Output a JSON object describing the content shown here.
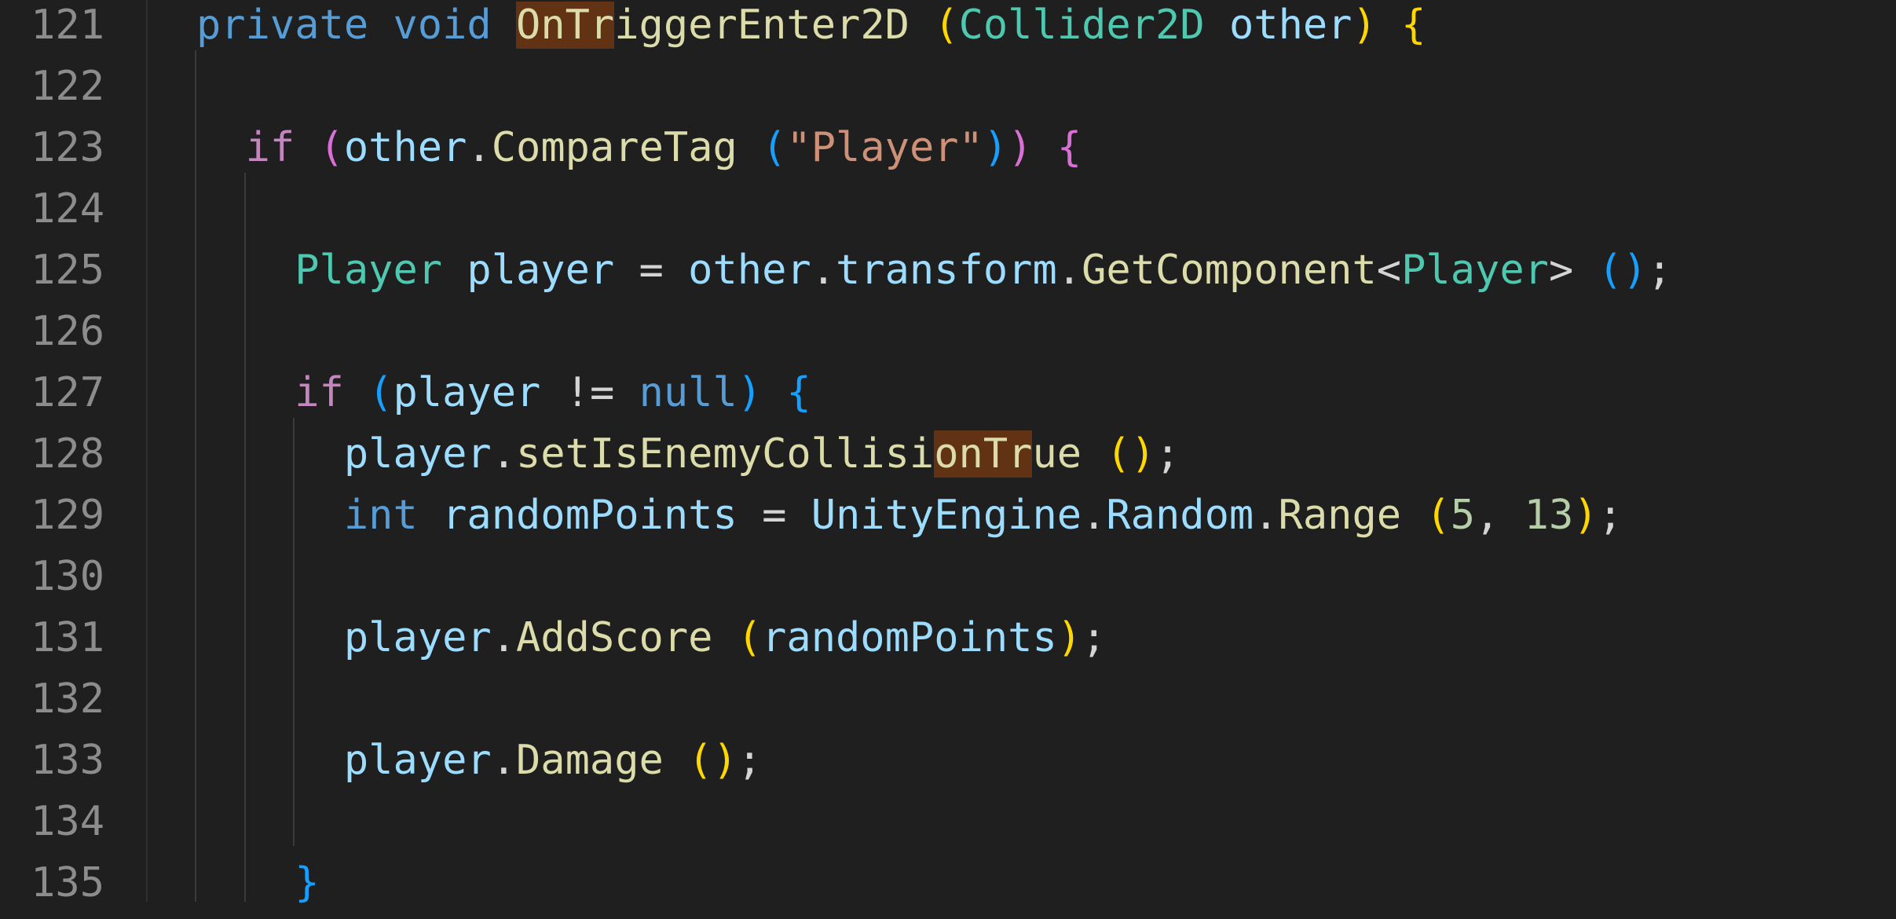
{
  "colors": {
    "background": "#1f1f1f",
    "line_number": "#8c8c8c",
    "keyword_blue": "#569cd6",
    "control_purple": "#c586c0",
    "function_yellow": "#dcdcaa",
    "type_teal": "#4ec9b0",
    "variable_lightblue": "#9cdcfe",
    "string_orange": "#ce9178",
    "number_green": "#b5cea8",
    "bracket_gold": "#ffd700",
    "bracket_orchid": "#da70d6",
    "bracket_sky": "#179fff",
    "punct": "#d4d4d4",
    "find_match": "#613214"
  },
  "lines": [
    {
      "number": "121",
      "tokens": [
        {
          "t": "private",
          "c": "keyword_blue"
        },
        {
          "t": " "
        },
        {
          "t": "void",
          "c": "keyword_blue"
        },
        {
          "t": " "
        },
        {
          "t": "OnTr",
          "c": "function_yellow",
          "hl": true
        },
        {
          "t": "iggerEnter2D",
          "c": "function_yellow"
        },
        {
          "t": " "
        },
        {
          "t": "(",
          "c": "bracket_gold"
        },
        {
          "t": "Collider2D",
          "c": "type_teal"
        },
        {
          "t": " "
        },
        {
          "t": "other",
          "c": "variable_lightblue"
        },
        {
          "t": ")",
          "c": "bracket_gold"
        },
        {
          "t": " "
        },
        {
          "t": "{",
          "c": "bracket_gold"
        }
      ]
    },
    {
      "number": "122",
      "tokens": []
    },
    {
      "number": "123",
      "tokens": [
        {
          "t": "  "
        },
        {
          "t": "if",
          "c": "control_purple"
        },
        {
          "t": " "
        },
        {
          "t": "(",
          "c": "bracket_orchid"
        },
        {
          "t": "other",
          "c": "variable_lightblue"
        },
        {
          "t": ".",
          "c": "punct"
        },
        {
          "t": "CompareTag",
          "c": "function_yellow"
        },
        {
          "t": " "
        },
        {
          "t": "(",
          "c": "bracket_sky"
        },
        {
          "t": "\"Player\"",
          "c": "string_orange"
        },
        {
          "t": ")",
          "c": "bracket_sky"
        },
        {
          "t": ")",
          "c": "bracket_orchid"
        },
        {
          "t": " "
        },
        {
          "t": "{",
          "c": "bracket_orchid"
        }
      ]
    },
    {
      "number": "124",
      "tokens": []
    },
    {
      "number": "125",
      "tokens": [
        {
          "t": "    "
        },
        {
          "t": "Player",
          "c": "type_teal"
        },
        {
          "t": " "
        },
        {
          "t": "player",
          "c": "variable_lightblue"
        },
        {
          "t": " = ",
          "c": "punct"
        },
        {
          "t": "other",
          "c": "variable_lightblue"
        },
        {
          "t": ".",
          "c": "punct"
        },
        {
          "t": "transform",
          "c": "variable_lightblue"
        },
        {
          "t": ".",
          "c": "punct"
        },
        {
          "t": "GetComponent",
          "c": "function_yellow"
        },
        {
          "t": "<",
          "c": "punct"
        },
        {
          "t": "Player",
          "c": "type_teal"
        },
        {
          "t": "> ",
          "c": "punct"
        },
        {
          "t": "()",
          "c": "bracket_sky"
        },
        {
          "t": ";",
          "c": "punct"
        }
      ]
    },
    {
      "number": "126",
      "tokens": []
    },
    {
      "number": "127",
      "tokens": [
        {
          "t": "    "
        },
        {
          "t": "if",
          "c": "control_purple"
        },
        {
          "t": " "
        },
        {
          "t": "(",
          "c": "bracket_sky"
        },
        {
          "t": "player",
          "c": "variable_lightblue"
        },
        {
          "t": " != ",
          "c": "punct"
        },
        {
          "t": "null",
          "c": "keyword_blue"
        },
        {
          "t": ")",
          "c": "bracket_sky"
        },
        {
          "t": " "
        },
        {
          "t": "{",
          "c": "bracket_sky"
        }
      ]
    },
    {
      "number": "128",
      "tokens": [
        {
          "t": "      "
        },
        {
          "t": "player",
          "c": "variable_lightblue"
        },
        {
          "t": ".",
          "c": "punct"
        },
        {
          "t": "setIsEnemyCollisi",
          "c": "function_yellow"
        },
        {
          "t": "onTr",
          "c": "function_yellow",
          "hl": true
        },
        {
          "t": "ue",
          "c": "function_yellow"
        },
        {
          "t": " "
        },
        {
          "t": "()",
          "c": "bracket_gold"
        },
        {
          "t": ";",
          "c": "punct"
        }
      ]
    },
    {
      "number": "129",
      "tokens": [
        {
          "t": "      "
        },
        {
          "t": "int",
          "c": "keyword_blue"
        },
        {
          "t": " "
        },
        {
          "t": "randomPoints",
          "c": "variable_lightblue"
        },
        {
          "t": " = ",
          "c": "punct"
        },
        {
          "t": "UnityEngine",
          "c": "variable_lightblue"
        },
        {
          "t": ".",
          "c": "punct"
        },
        {
          "t": "Random",
          "c": "variable_lightblue"
        },
        {
          "t": ".",
          "c": "punct"
        },
        {
          "t": "Range",
          "c": "function_yellow"
        },
        {
          "t": " "
        },
        {
          "t": "(",
          "c": "bracket_gold"
        },
        {
          "t": "5",
          "c": "number_green"
        },
        {
          "t": ", ",
          "c": "punct"
        },
        {
          "t": "13",
          "c": "number_green"
        },
        {
          "t": ")",
          "c": "bracket_gold"
        },
        {
          "t": ";",
          "c": "punct"
        }
      ]
    },
    {
      "number": "130",
      "tokens": []
    },
    {
      "number": "131",
      "tokens": [
        {
          "t": "      "
        },
        {
          "t": "player",
          "c": "variable_lightblue"
        },
        {
          "t": ".",
          "c": "punct"
        },
        {
          "t": "AddScore",
          "c": "function_yellow"
        },
        {
          "t": " "
        },
        {
          "t": "(",
          "c": "bracket_gold"
        },
        {
          "t": "randomPoints",
          "c": "variable_lightblue"
        },
        {
          "t": ")",
          "c": "bracket_gold"
        },
        {
          "t": ";",
          "c": "punct"
        }
      ]
    },
    {
      "number": "132",
      "tokens": []
    },
    {
      "number": "133",
      "tokens": [
        {
          "t": "      "
        },
        {
          "t": "player",
          "c": "variable_lightblue"
        },
        {
          "t": ".",
          "c": "punct"
        },
        {
          "t": "Damage",
          "c": "function_yellow"
        },
        {
          "t": " "
        },
        {
          "t": "()",
          "c": "bracket_gold"
        },
        {
          "t": ";",
          "c": "punct"
        }
      ]
    },
    {
      "number": "134",
      "tokens": []
    },
    {
      "number": "135",
      "tokens": [
        {
          "t": "    "
        },
        {
          "t": "}",
          "c": "bracket_sky"
        }
      ]
    }
  ]
}
